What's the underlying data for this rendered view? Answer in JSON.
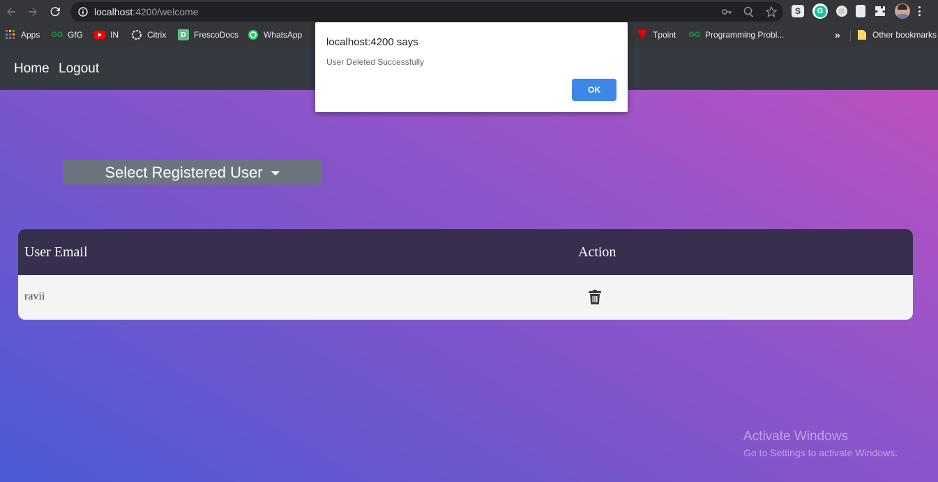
{
  "browser": {
    "url_host": "localhost",
    "url_path": ":4200/welcome",
    "bookmarks": [
      {
        "label": "Apps",
        "icon": "apps-grid-icon"
      },
      {
        "label": "GfG",
        "icon": "gfg-icon"
      },
      {
        "label": "IN",
        "icon": "youtube-icon"
      },
      {
        "label": "Citrix",
        "icon": "citrix-icon"
      },
      {
        "label": "FrescoDocs",
        "icon": "frescodocs-icon"
      },
      {
        "label": "WhatsApp",
        "icon": "whatsapp-icon"
      },
      {
        "label": "Tpoint",
        "icon": "tpoint-icon"
      },
      {
        "label": "Programming Probl...",
        "icon": "gfg-icon"
      },
      {
        "label": "Other bookmarks",
        "icon": "folder-icon"
      }
    ],
    "more_bookmarks": "»"
  },
  "navbar": {
    "home": "Home",
    "logout": "Logout"
  },
  "select_user": {
    "label": "Select Registered User"
  },
  "table": {
    "headers": [
      "User Email",
      "Action"
    ],
    "rows": [
      {
        "email": "ravii"
      }
    ]
  },
  "dialog": {
    "title": "localhost:4200 says",
    "message": "User Deleted Successfully",
    "ok": "OK"
  },
  "watermark": {
    "title": "Activate Windows",
    "subtitle": "Go to Settings to activate Windows."
  },
  "colors": {
    "navbar": "#343a40",
    "table_header": "#382f4e",
    "ok_button": "#3d87e8",
    "select_button": "#6c757d"
  }
}
